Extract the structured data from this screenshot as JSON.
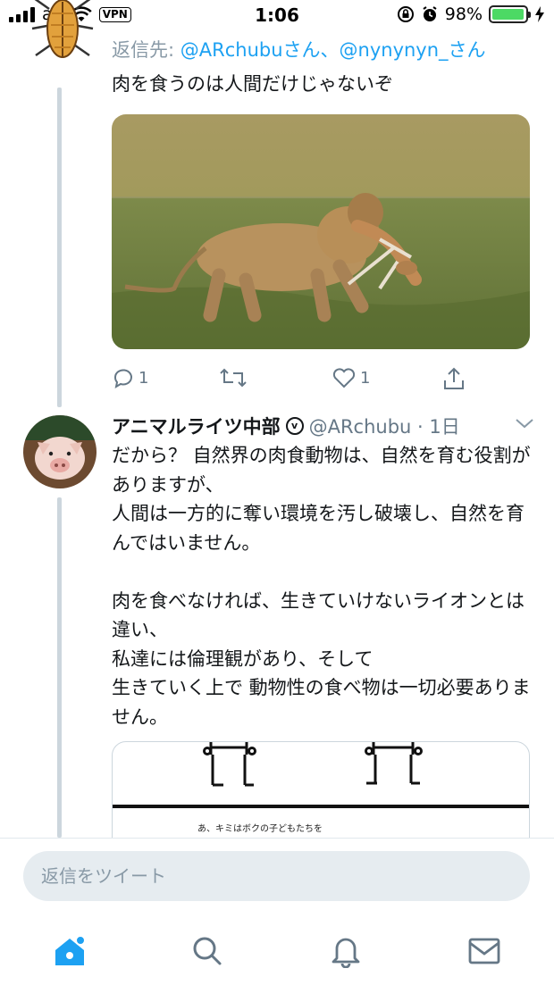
{
  "status_bar": {
    "carrier": "au",
    "vpn": "VPN",
    "time": "1:06",
    "battery": "98%",
    "battery_level": 0.98
  },
  "thread": [
    {
      "reply_to_label": "返信先: ",
      "reply_to_handles": "@ARchubuさん、@nynynyn_さん",
      "text": "肉を食うのは人間だけじゃないぞ",
      "media_icon": "lion-carrying-antelope-photo",
      "replies": "1",
      "likes": "1"
    },
    {
      "name": "アニマルライツ中部",
      "verified_icon": "v",
      "meta": "@ARchubu · 1日",
      "text": "だから？ 自然界の肉食動物は、自然を育む役割がありますが、\n人間は一方的に奪い環境を汚し破壊し、自然を育んではいません。\n\n肉を食べなければ、生きていけないライオンとは違い、\n私達には倫理観があり、そして\n生きていく上で 動物性の食べ物は一切必要ありません。",
      "media_text": "あ、キミはボクの子どもたちを"
    }
  ],
  "reply_box": {
    "placeholder": "返信をツイート"
  },
  "colors": {
    "accent": "#1da1f2",
    "muted": "#657786",
    "line": "#ccd6dd"
  }
}
